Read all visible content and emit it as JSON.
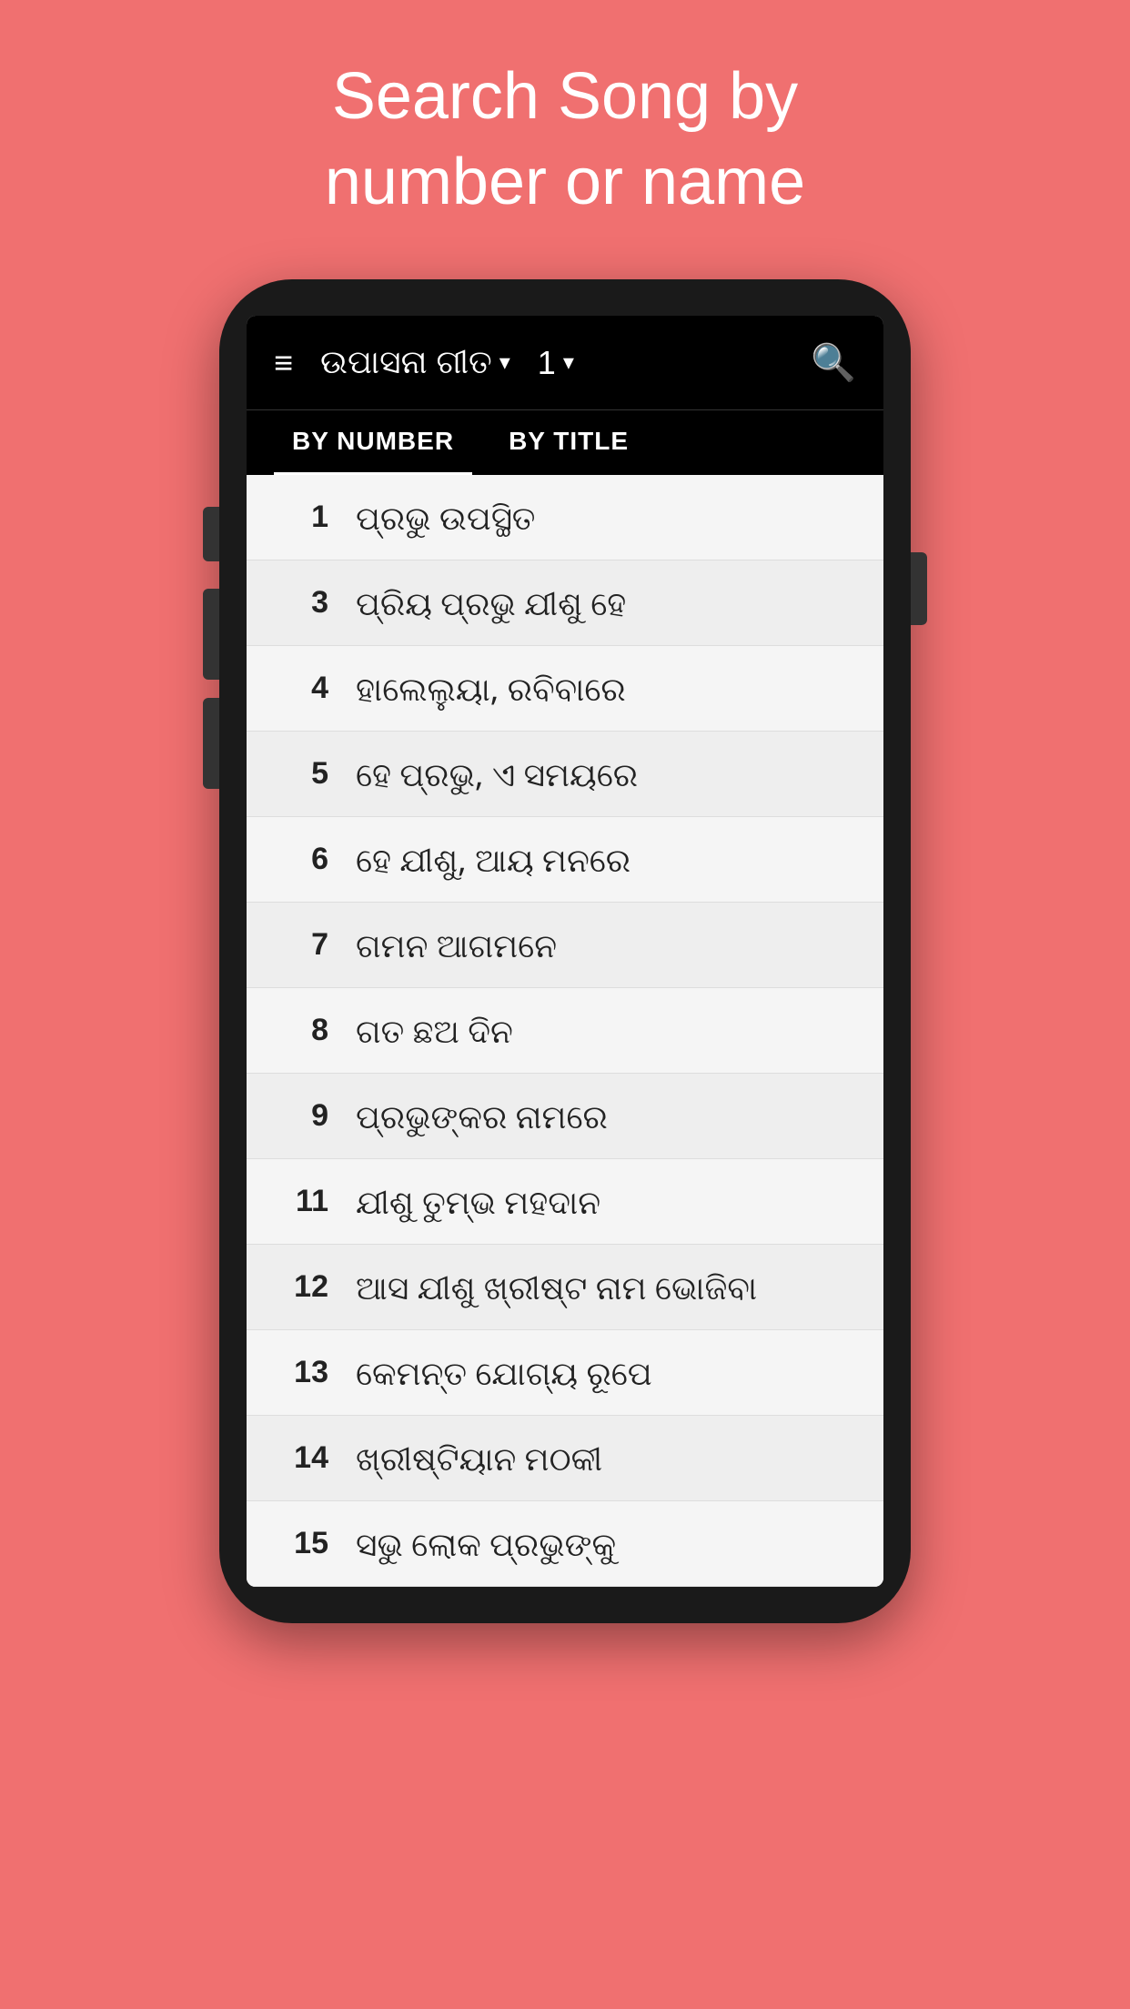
{
  "header": {
    "line1": "Search Song by",
    "line2": "number or name"
  },
  "toolbar": {
    "title": "ଉପାସନା ଗୀତ",
    "number": "1",
    "hamburger": "≡",
    "search": "🔍"
  },
  "tabs": [
    {
      "label": "BY NUMBER",
      "active": true
    },
    {
      "label": "BY TITLE",
      "active": false
    }
  ],
  "songs": [
    {
      "number": "1",
      "title": "ପ୍ରଭୁ ଉପସ୍ଥିତ"
    },
    {
      "number": "3",
      "title": "ପ୍ରିୟ ପ୍ରଭୁ ଯୀଶୁ ହେ"
    },
    {
      "number": "4",
      "title": "ହାଲେଲୁୟା, ରବିବାରେ"
    },
    {
      "number": "5",
      "title": "ହେ ପ୍ରଭୁ, ଏ ସମୟରେ"
    },
    {
      "number": "6",
      "title": "ହେ ଯୀଶୁ, ଆୟ ମନରେ"
    },
    {
      "number": "7",
      "title": "ଗମନ ଆଗମନେ"
    },
    {
      "number": "8",
      "title": "ଗତ ଛଅ ଦିନ"
    },
    {
      "number": "9",
      "title": "ପ୍ରଭୁଙ୍କର ନାମରେ"
    },
    {
      "number": "11",
      "title": "ଯୀଶୁ ତୁମ୍ଭ ମହଦାନ"
    },
    {
      "number": "12",
      "title": "ଆସ ଯୀଶୁ ଖ୍ରୀଷ୍ଟ ନାମ ଭୋଜିବା"
    },
    {
      "number": "13",
      "title": "କେମନ୍ତ ଯୋଗ୍ୟ ରୂପେ"
    },
    {
      "number": "14",
      "title": "ଖ୍ରୀଷ୍ଟିୟାନ ମଠକୀ"
    },
    {
      "number": "15",
      "title": "ସଭୁ ଲୋକ ପ୍ରଭୁଙ୍କୁ"
    }
  ],
  "colors": {
    "background": "#f07070",
    "toolbar_bg": "#000000",
    "list_bg": "#f5f5f5",
    "text_white": "#ffffff",
    "text_dark": "#222222"
  }
}
